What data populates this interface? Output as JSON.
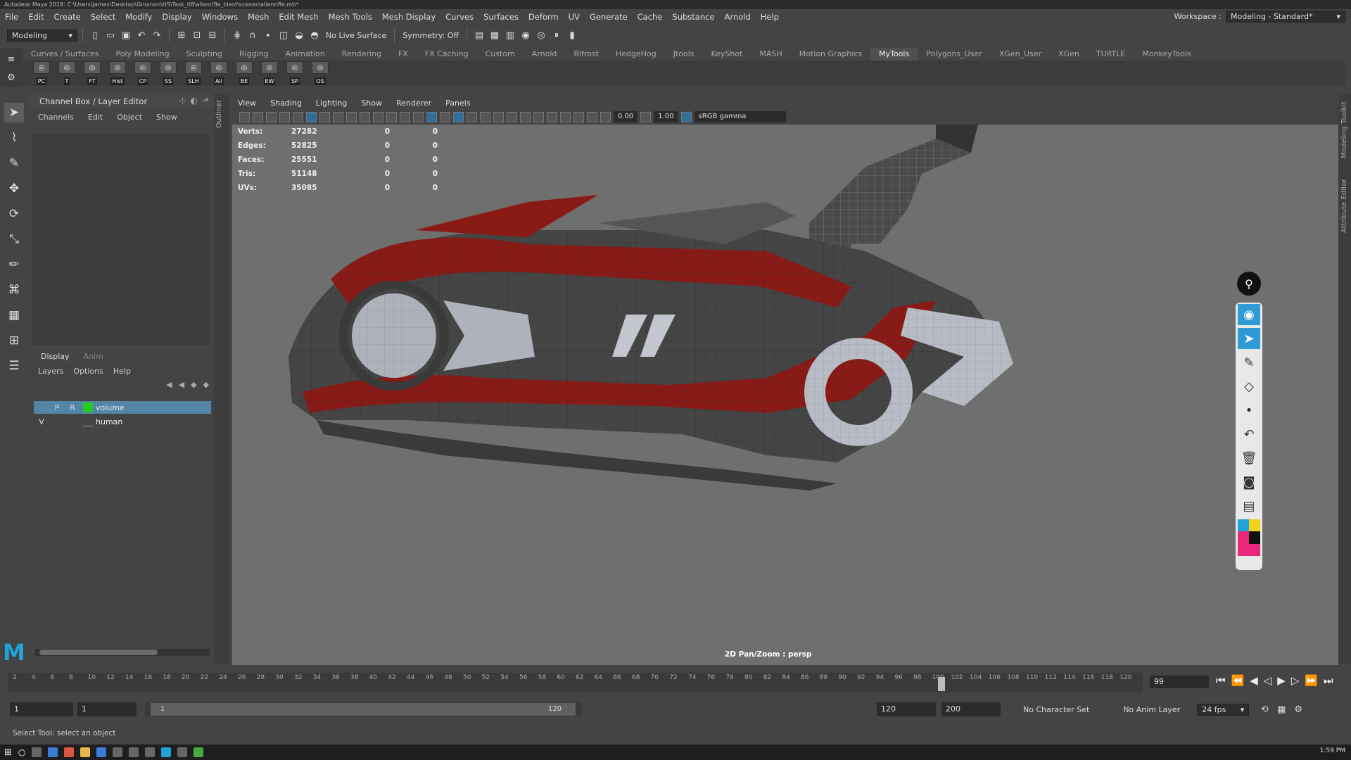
{
  "window": {
    "title": "Autodesk Maya 2018: C:\\Users\\James\\Desktop\\Gnomon\\HS\\Task_08\\alienrifle_blast\\scenes\\alienrifle.mb*"
  },
  "menubar": {
    "items": [
      "File",
      "Edit",
      "Create",
      "Select",
      "Modify",
      "Display",
      "Windows",
      "Mesh",
      "Edit Mesh",
      "Mesh Tools",
      "Mesh Display",
      "Curves",
      "Surfaces",
      "Deform",
      "UV",
      "Generate",
      "Cache",
      "Substance",
      "Arnold",
      "Help"
    ]
  },
  "workspace": {
    "label": "Workspace :",
    "value": "Modeling - Standard*"
  },
  "statusline": {
    "mode": "Modeling",
    "live_surface": "No Live Surface",
    "symmetry": "Symmetry: Off"
  },
  "shelf": {
    "tabs": [
      "Curves / Surfaces",
      "Poly Modeling",
      "Sculpting",
      "Rigging",
      "Animation",
      "Rendering",
      "FX",
      "FX Caching",
      "Custom",
      "Arnold",
      "Bifrost",
      "HedgeHog",
      "Jtools",
      "KeyShot",
      "MASH",
      "Motion Graphics",
      "MyTools",
      "Polygons_User",
      "XGen_User",
      "XGen",
      "TURTLE",
      "MonkeyTools"
    ],
    "active_tab": "MyTools",
    "buttons": [
      "PC",
      "T",
      "FT",
      "Hist",
      "CP",
      "SS",
      "SLH",
      "All",
      "BE",
      "EW",
      "SP",
      "OS"
    ]
  },
  "channelbox": {
    "title": "Channel Box / Layer Editor",
    "menu": [
      "Channels",
      "Edit",
      "Object",
      "Show"
    ]
  },
  "layers": {
    "tabs": [
      "Display",
      "Anim"
    ],
    "menu": [
      "Layers",
      "Options",
      "Help"
    ],
    "rows": [
      {
        "visible": "",
        "p": "P",
        "r": "R",
        "color": "#22cc22",
        "name": "volume",
        "selected": true
      },
      {
        "visible": "V",
        "p": "",
        "r": "",
        "color": "",
        "name": "human",
        "selected": false
      }
    ]
  },
  "outliner_label": "Outliner",
  "viewport": {
    "menu": [
      "View",
      "Shading",
      "Lighting",
      "Show",
      "Renderer",
      "Panels"
    ],
    "exposure": "0.00",
    "gamma": "1.00",
    "colorspace": "sRGB gamma",
    "camera_label": "2D Pan/Zoom : persp",
    "hud": [
      {
        "label": "Verts:",
        "value": "27282",
        "c1": "0",
        "c2": "0"
      },
      {
        "label": "Edges:",
        "value": "52825",
        "c1": "0",
        "c2": "0"
      },
      {
        "label": "Faces:",
        "value": "25551",
        "c1": "0",
        "c2": "0"
      },
      {
        "label": "Tris:",
        "value": "51148",
        "c1": "0",
        "c2": "0"
      },
      {
        "label": "UVs:",
        "value": "35085",
        "c1": "0",
        "c2": "0"
      }
    ]
  },
  "side_tabs": [
    "Modeling Toolkit",
    "Attribute Editor"
  ],
  "timeline": {
    "ticks": [
      "2",
      "4",
      "6",
      "8",
      "10",
      "12",
      "14",
      "16",
      "18",
      "20",
      "22",
      "24",
      "26",
      "28",
      "30",
      "32",
      "34",
      "36",
      "38",
      "40",
      "42",
      "44",
      "46",
      "48",
      "50",
      "52",
      "54",
      "56",
      "58",
      "60",
      "62",
      "64",
      "66",
      "68",
      "70",
      "72",
      "74",
      "76",
      "78",
      "80",
      "82",
      "84",
      "86",
      "88",
      "90",
      "92",
      "94",
      "96",
      "98",
      "100",
      "102",
      "104",
      "106",
      "108",
      "110",
      "112",
      "114",
      "116",
      "118",
      "120"
    ],
    "current_frame": "99"
  },
  "range": {
    "start": "1",
    "playback_start": "1",
    "slider_start": "1",
    "slider_end": "120",
    "playback_end": "120",
    "end": "200",
    "character_set": "No Character Set",
    "anim_layer": "No Anim Layer",
    "fps": "24 fps"
  },
  "helpline": "Select Tool: select an object",
  "clock": "1:59 PM",
  "colors": {
    "accent": "#5285a6",
    "layer_volume": "#22cc22",
    "model_red": "#8a1a16",
    "palette_select": "#2e9bd6"
  }
}
